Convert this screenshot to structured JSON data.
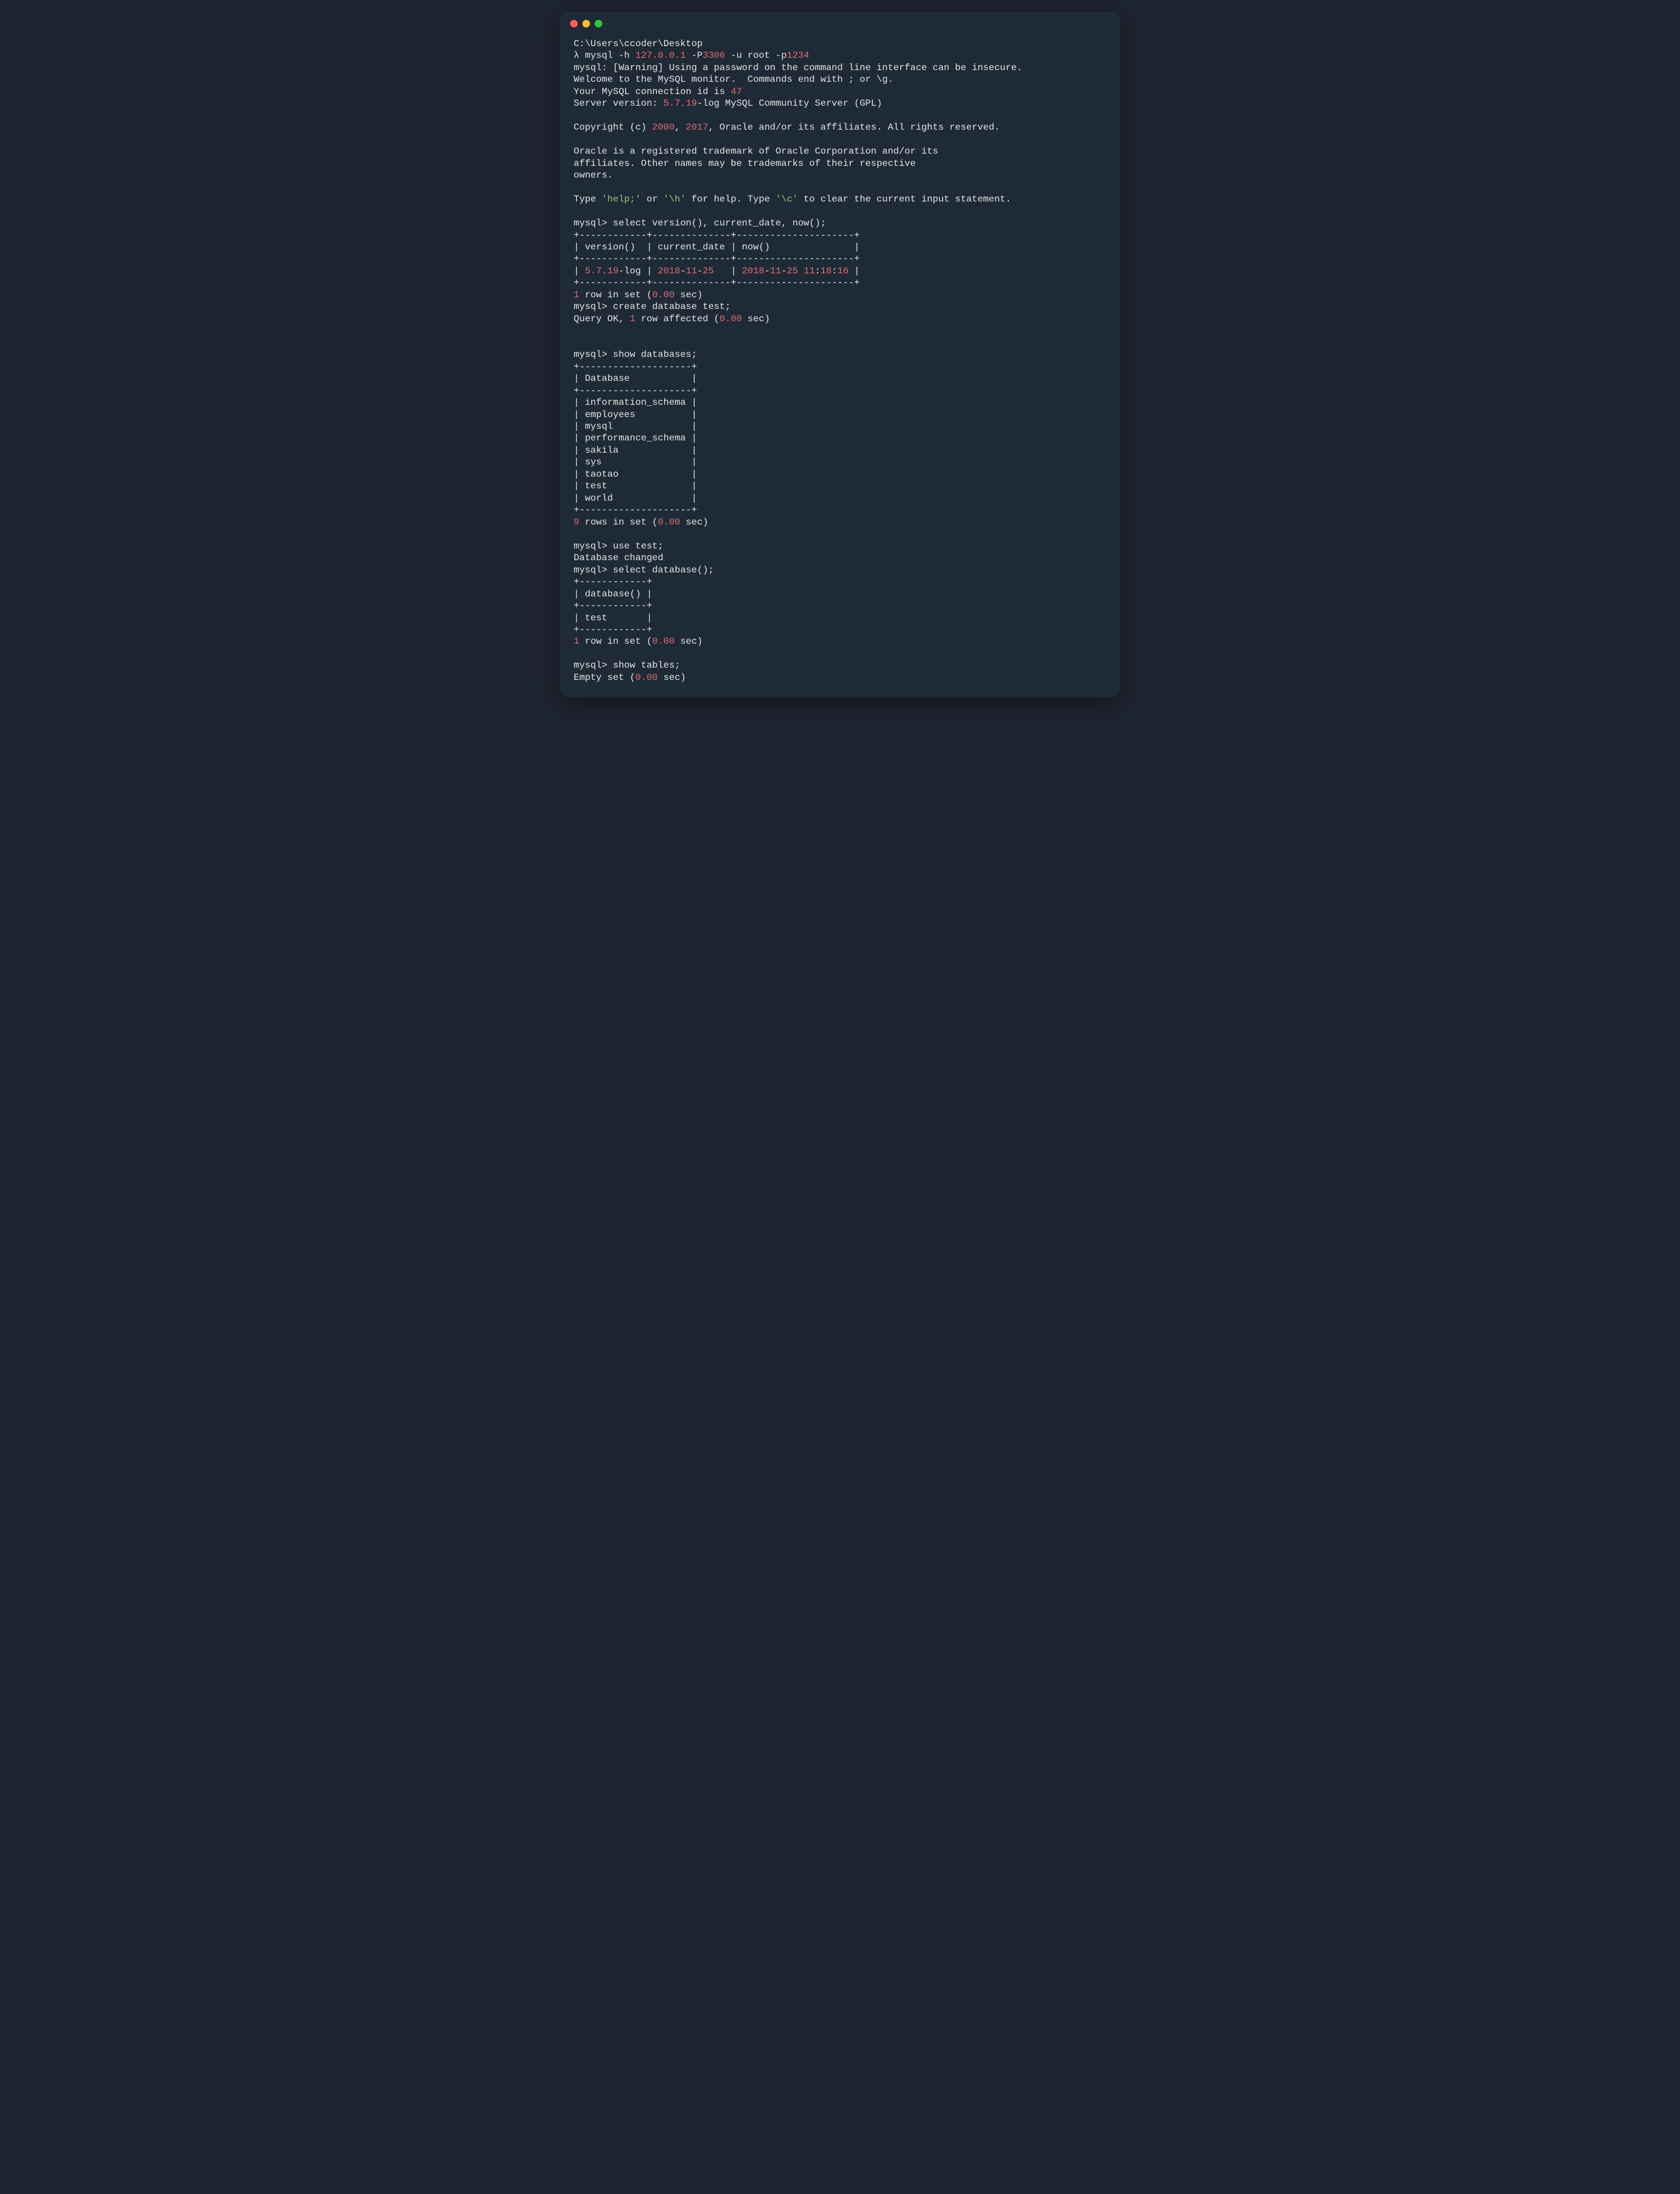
{
  "prompt_path": "C:\\Users\\ccoder\\Desktop",
  "prompt_lambda": "λ ",
  "cmd_mysql_bin": "mysql",
  "cmd_mysql_h_flag": " -h ",
  "cmd_mysql_host": "127.0.0.1",
  "cmd_mysql_P_pre": " -P",
  "cmd_mysql_port": "3306",
  "cmd_mysql_rest": " -u root -p",
  "cmd_mysql_pw": "1234",
  "warn_line": "mysql: [Warning] Using a password on the command line interface can be insecure.",
  "welcome_line": "Welcome to the MySQL monitor.  Commands end with ; or \\g.",
  "conn_pre": "Your MySQL connection id is ",
  "conn_id": "47",
  "srv_pre": "Server version: ",
  "srv_ver_num": "5.7.19",
  "srv_suffix": "-log MySQL Community Server (GPL)",
  "copyright_pre": "Copyright (c) ",
  "copyright_y1": "2000",
  "copyright_comma": ", ",
  "copyright_y2": "2017",
  "copyright_post": ", Oracle and/or its affiliates. All rights reserved.",
  "oracle_l1": "Oracle is a registered trademark of Oracle Corporation and/or its",
  "oracle_l2": "affiliates. Other names may be trademarks of their respective",
  "oracle_l3": "owners.",
  "type_pre": "Type ",
  "type_help": "'help;'",
  "type_or": " or ",
  "type_h": "'\\h'",
  "type_mid": " for help. Type ",
  "type_c": "'\\c'",
  "type_post": " to clear the current input statement.",
  "mysql_prompt": "mysql> ",
  "q1": "select version(), current_date, now();",
  "t1_border": "+------------+--------------+---------------------+",
  "t1_header": "| version()  | current_date | now()               |",
  "t1_row_pre": "| ",
  "t1_ver": "5.7.19",
  "t1_ver_suffix": "-log | ",
  "t1_date_y": "2018",
  "t1_dash": "-",
  "t1_date_m": "11",
  "t1_date_d": "25",
  "t1_date_pad": "   | ",
  "t1_now_h": "11",
  "t1_colon": ":",
  "t1_now_mi": "18",
  "t1_now_s": "16",
  "t1_now_pad": " |",
  "r1_pre_num": "1",
  "r1_text": " row in set (",
  "r1_sec": "0.00",
  "r1_close": " sec)",
  "q2": "create database test;",
  "q2_res_pre": "Query OK, ",
  "q2_res_one": "1",
  "q2_res_mid": " row affected (",
  "q3": "show databases;",
  "t3_border": "+--------------------+",
  "t3_header": "| Database           |",
  "t3_r1": "| information_schema |",
  "t3_r2": "| employees          |",
  "t3_r3": "| mysql              |",
  "t3_r4": "| performance_schema |",
  "t3_r5": "| sakila             |",
  "t3_r6": "| sys                |",
  "t3_r7": "| taotao             |",
  "t3_r8": "| test               |",
  "t3_r9": "| world              |",
  "r3_pre_num": "9",
  "r3_text": " rows in set (",
  "q4": "use test;",
  "q4_res": "Database changed",
  "q5": "select database();",
  "t5_border": "+------------+",
  "t5_header": "| database() |",
  "t5_row": "| test       |",
  "q6": "show tables;",
  "q6_res_pre": "Empty set (",
  "space": " "
}
